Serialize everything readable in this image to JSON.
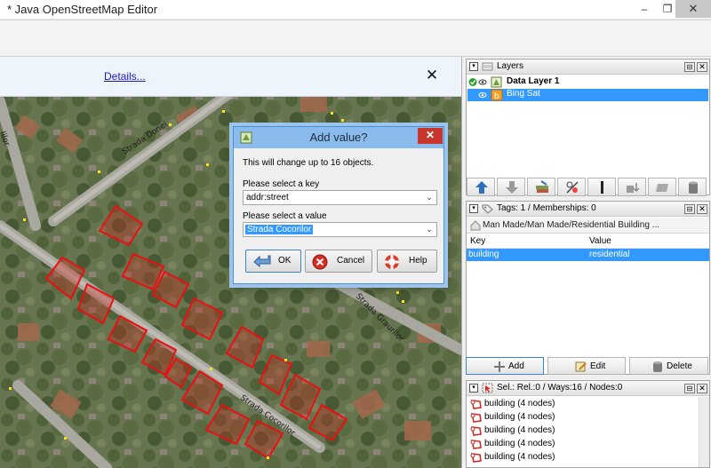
{
  "window": {
    "title": "* Java OpenStreetMap Editor",
    "minimize_glyph": "–",
    "maximize_glyph": "❐",
    "close_glyph": "✕"
  },
  "infobar": {
    "details_link": "Details...",
    "close_glyph": "✕"
  },
  "map": {
    "street_labels": [
      "Strada Donei",
      "Strada Cocorilor",
      "Strada Graurilor",
      "Iilor"
    ]
  },
  "dialog": {
    "title": "Add value?",
    "close_glyph": "✕",
    "info": "This will change up to 16 objects.",
    "key_label": "Please select a key",
    "key_value": "addr:street",
    "value_label": "Please select a value",
    "value_value": "Strada Cocorilor",
    "ok_label": "OK",
    "cancel_label": "Cancel",
    "help_label": "Help",
    "combo_arrow": "⌄"
  },
  "layers_panel": {
    "title": "Layers",
    "collapse_glyph": "▾",
    "items": [
      {
        "label": "Data Layer 1",
        "active": true
      },
      {
        "label": "Bing Sat",
        "active": false
      }
    ]
  },
  "tags_panel": {
    "title": "Tags: 1 / Memberships: 0",
    "preset": "Man Made/Man Made/Residential Building ...",
    "col_key": "Key",
    "col_value": "Value",
    "rows": [
      {
        "key": "building",
        "value": "residential"
      }
    ],
    "add_label": "Add",
    "edit_label": "Edit",
    "delete_label": "Delete"
  },
  "selection_panel": {
    "title": "Sel.: Rel.:0 / Ways:16 / Nodes:0",
    "items": [
      "building (4 nodes)",
      "building (4 nodes)",
      "building (4 nodes)",
      "building (4 nodes)",
      "building (4 nodes)"
    ]
  },
  "colors": {
    "selection_blue": "#3399ff",
    "dialog_title": "#8bbbec",
    "close_red": "#c8372d",
    "building_red": "#e81010"
  }
}
